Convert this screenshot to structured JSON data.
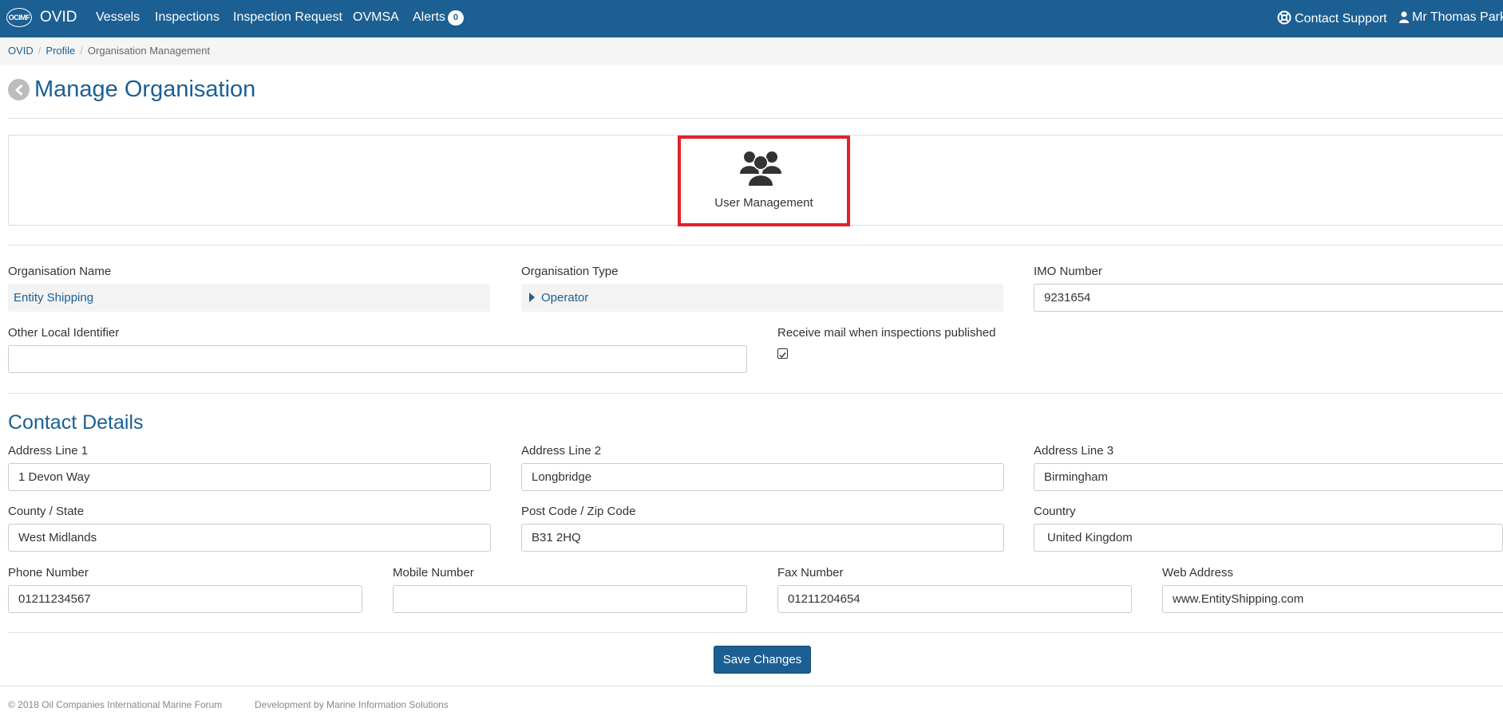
{
  "navbar": {
    "logo_text": "OCIMF",
    "brand": "OVID",
    "links": [
      "Vessels",
      "Inspections",
      "Inspection Request",
      "OVMSA",
      "Alerts"
    ],
    "alerts_count": "0",
    "contact_support": "Contact Support",
    "user_name": "Mr Thomas Parke"
  },
  "breadcrumb": {
    "items": [
      "OVID",
      "Profile"
    ],
    "current": "Organisation Management"
  },
  "page": {
    "title": "Manage Organisation"
  },
  "tiles": {
    "user_management": "User Management"
  },
  "organisation": {
    "name_label": "Organisation Name",
    "name_value": "Entity Shipping",
    "type_label": "Organisation Type",
    "type_value": "Operator",
    "imo_label": "IMO Number",
    "imo_value": "9231654",
    "other_id_label": "Other Local Identifier",
    "other_id_value": "",
    "receive_mail_label": "Receive mail when inspections published",
    "receive_mail_checked": true
  },
  "contact": {
    "section_title": "Contact Details",
    "address1_label": "Address Line 1",
    "address1_value": "1 Devon Way",
    "address2_label": "Address Line 2",
    "address2_value": "Longbridge",
    "address3_label": "Address Line 3",
    "address3_value": "Birmingham",
    "county_label": "County / State",
    "county_value": "West Midlands",
    "postcode_label": "Post Code / Zip Code",
    "postcode_value": "B31 2HQ",
    "country_label": "Country",
    "country_value": "United Kingdom",
    "phone_label": "Phone Number",
    "phone_value": "01211234567",
    "mobile_label": "Mobile Number",
    "mobile_value": "",
    "fax_label": "Fax Number",
    "fax_value": "01211204654",
    "web_label": "Web Address",
    "web_value": "www.EntityShipping.com"
  },
  "actions": {
    "save_label": "Save Changes"
  },
  "footer": {
    "copyright": "© 2018 Oil Companies International Marine Forum",
    "development": "Development by Marine Information Solutions"
  },
  "colors": {
    "primary": "#1c5f93",
    "highlight": "#e3202a"
  }
}
